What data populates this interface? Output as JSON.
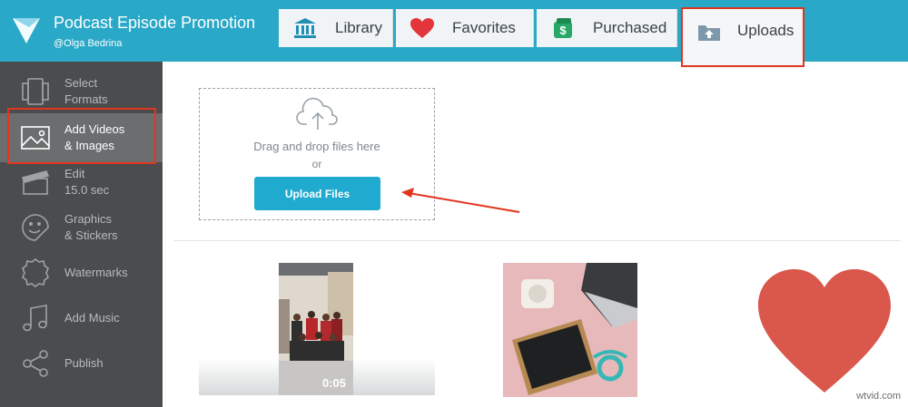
{
  "project": {
    "title": "Podcast Episode Promotion",
    "user": "@Olga Bedrina"
  },
  "tabs": [
    {
      "label": "Library",
      "icon": "library-icon"
    },
    {
      "label": "Favorites",
      "icon": "heart-icon"
    },
    {
      "label": "Purchased",
      "icon": "dollar-icon"
    },
    {
      "label": "Uploads",
      "icon": "upload-folder-icon",
      "active": true
    }
  ],
  "sidebar": {
    "items": [
      {
        "label_line1": "Select",
        "label_line2": "Formats",
        "icon": "formats-icon"
      },
      {
        "label_line1": "Add Videos",
        "label_line2": "& Images",
        "icon": "image-icon",
        "active": true
      },
      {
        "label_line1": "Edit",
        "label_line2": "15.0 sec",
        "icon": "clapperboard-icon"
      },
      {
        "label_line1": "Graphics",
        "label_line2": "& Stickers",
        "icon": "sticker-icon"
      },
      {
        "label_line1": "Watermarks",
        "label_line2": "",
        "icon": "watermark-icon"
      },
      {
        "label_line1": "Add Music",
        "label_line2": "",
        "icon": "music-icon"
      },
      {
        "label_line1": "Publish",
        "label_line2": "",
        "icon": "share-icon"
      }
    ]
  },
  "upload": {
    "drag_text": "Drag and drop files here",
    "or_text": "or",
    "button_label": "Upload Files"
  },
  "media": [
    {
      "type": "video",
      "duration": "0:05"
    },
    {
      "type": "image"
    },
    {
      "type": "image"
    }
  ],
  "watermark": "wtvid.com",
  "colors": {
    "header": "#2aa8c8",
    "sidebar": "#4a4c4e",
    "accent_button": "#20aacf",
    "highlight": "#e2351f",
    "heart": "#d9574b"
  }
}
